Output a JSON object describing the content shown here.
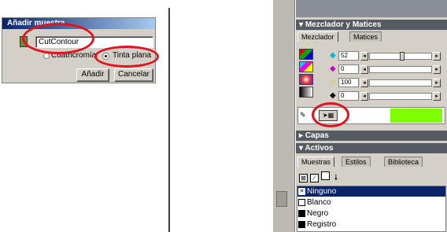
{
  "dialog": {
    "title": "Añadir muestra",
    "name_value": "CutContour",
    "radio_spot_label": "Cuatricromía",
    "radio_tint_label": "Tinta plana",
    "add_label": "Añadir",
    "cancel_label": "Cancelar"
  },
  "mixer_panel": {
    "title": "Mezclador y Matices",
    "tabs": [
      "Mezclador",
      "Matices"
    ],
    "values": [
      "52",
      "0",
      "100",
      "0"
    ]
  },
  "layers_panel": {
    "title": "Capas"
  },
  "assets_panel": {
    "title": "Activos",
    "tabs": [
      "Muestras",
      "Estilos",
      "Biblioteca"
    ],
    "swatches": [
      "Ninguno",
      "Blanco",
      "Negro",
      "Registro"
    ]
  },
  "colors": {
    "accent_green": "#7dff00",
    "highlight": "#0a246a",
    "annotation": "#e0141e"
  }
}
